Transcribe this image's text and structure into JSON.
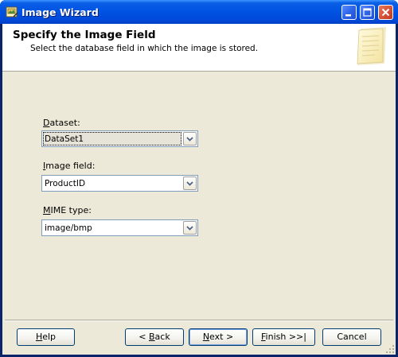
{
  "window": {
    "title": "Image Wizard",
    "icon": "wizard-icon"
  },
  "header": {
    "title": "Specify the Image Field",
    "subtitle": "Select the database field in which the image is stored.",
    "graphic": "notepad-icon"
  },
  "fields": {
    "dataset": {
      "label_first": "D",
      "label_rest": "ataset:",
      "value": "DataSet1"
    },
    "image_field": {
      "label_first": "I",
      "label_rest": "mage field:",
      "value": "ProductID"
    },
    "mime_type": {
      "label_first": "M",
      "label_rest": "IME type:",
      "value": "image/bmp"
    }
  },
  "buttons": {
    "help": {
      "acc": "H",
      "rest": "elp"
    },
    "back": {
      "pre": "< ",
      "acc": "B",
      "rest": "ack"
    },
    "next": {
      "acc": "N",
      "rest": "ext >"
    },
    "finish": {
      "acc": "F",
      "rest": "inish >>|"
    },
    "cancel": {
      "label": "Cancel"
    }
  },
  "colors": {
    "titlebar": "#0054e3",
    "client": "#ece9d8",
    "combo_border": "#7f9db9"
  }
}
